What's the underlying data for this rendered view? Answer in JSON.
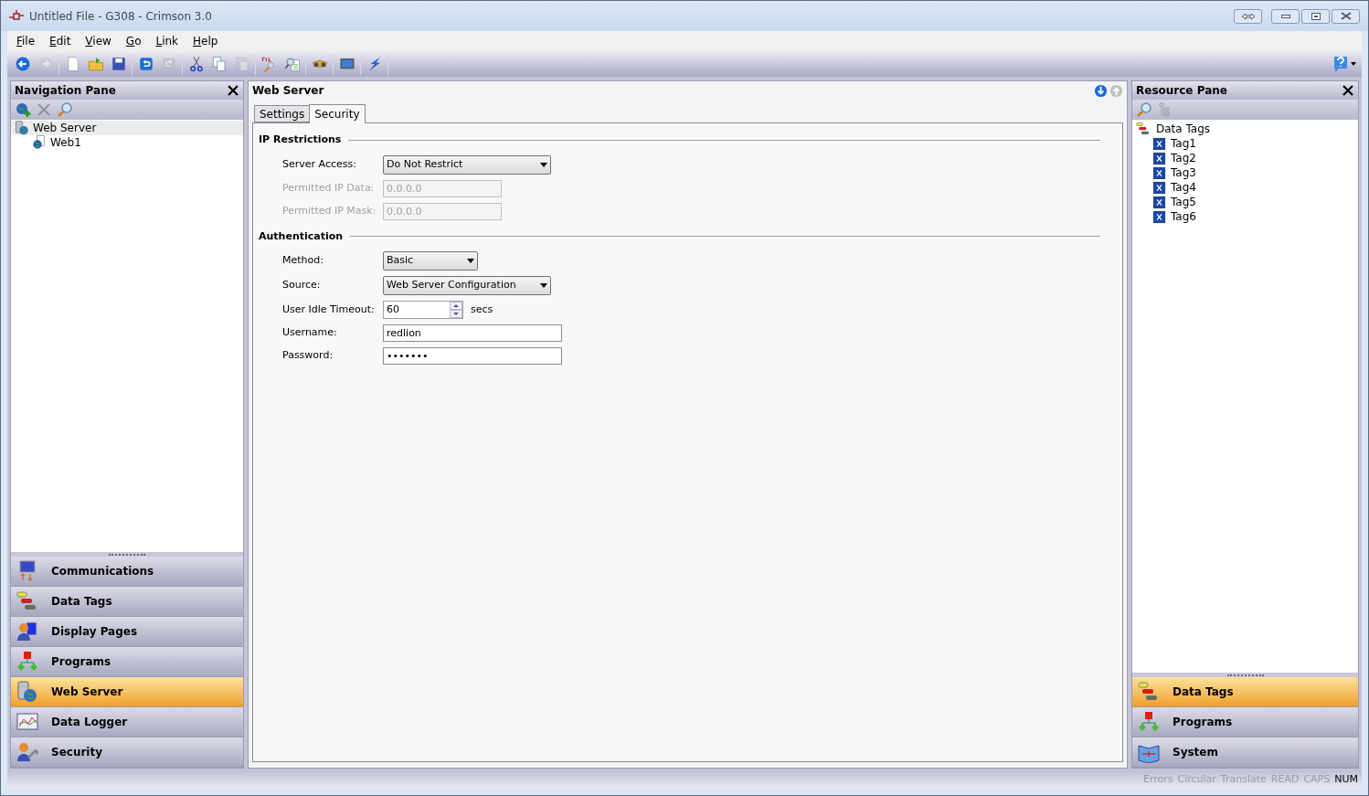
{
  "window": {
    "title": "Untitled File - G308 - Crimson 3.0"
  },
  "menu": [
    "File",
    "Edit",
    "View",
    "Go",
    "Link",
    "Help"
  ],
  "toolbar": [
    [
      {
        "kind": "back",
        "disabled": false
      },
      {
        "kind": "forward",
        "disabled": true
      }
    ],
    [
      {
        "kind": "new",
        "disabled": false
      },
      {
        "kind": "open",
        "disabled": false
      },
      {
        "kind": "save",
        "disabled": false
      }
    ],
    [
      {
        "kind": "undo",
        "disabled": false
      },
      {
        "kind": "redo",
        "disabled": true
      }
    ],
    [
      {
        "kind": "cut",
        "disabled": false
      },
      {
        "kind": "copy",
        "disabled": false
      },
      {
        "kind": "paste",
        "disabled": true
      }
    ],
    [
      {
        "kind": "find-all",
        "disabled": false
      },
      {
        "kind": "find",
        "disabled": false
      }
    ],
    [
      {
        "kind": "binoculars",
        "disabled": false
      }
    ],
    [
      {
        "kind": "monitor",
        "disabled": false
      }
    ],
    [
      {
        "kind": "lightning",
        "disabled": false
      }
    ]
  ],
  "navigation_pane": {
    "title": "Navigation Pane",
    "tree": [
      {
        "label": "Web Server",
        "kind": "server",
        "selected": true,
        "children": [
          {
            "label": "Web1",
            "kind": "globe",
            "selected": false
          }
        ]
      }
    ],
    "categories": [
      {
        "label": "Communications",
        "kind": "communications",
        "selected": false
      },
      {
        "label": "Data Tags",
        "kind": "tags",
        "selected": false
      },
      {
        "label": "Display Pages",
        "kind": "display",
        "selected": false
      },
      {
        "label": "Programs",
        "kind": "programs",
        "selected": false
      },
      {
        "label": "Web Server",
        "kind": "server",
        "selected": true
      },
      {
        "label": "Data Logger",
        "kind": "logger",
        "selected": false
      },
      {
        "label": "Security",
        "kind": "security",
        "selected": false
      }
    ]
  },
  "editor": {
    "title": "Web Server",
    "tabs": [
      {
        "label": "Settings",
        "selected": false
      },
      {
        "label": "Security",
        "selected": true
      }
    ],
    "sections": [
      {
        "title": "IP Restrictions",
        "fields": [
          {
            "kind": "select",
            "label": "Server Access:",
            "value": "Do Not Restrict",
            "disabled": false
          },
          {
            "kind": "text",
            "label": "Permitted IP Data:",
            "value": "0.0.0.0",
            "disabled": true
          },
          {
            "kind": "text",
            "label": "Permitted IP Mask:",
            "value": "0.0.0.0",
            "disabled": true
          }
        ]
      },
      {
        "title": "Authentication",
        "fields": [
          {
            "kind": "select",
            "label": "Method:",
            "value": "Basic",
            "disabled": false
          },
          {
            "kind": "select",
            "label": "Source:",
            "value": "Web Server Configuration",
            "disabled": false
          },
          {
            "kind": "spinner",
            "label": "User Idle Timeout:",
            "value": "60",
            "unit": "secs",
            "disabled": false
          },
          {
            "kind": "text",
            "label": "Username:",
            "value": "redlion",
            "disabled": false
          },
          {
            "kind": "text",
            "label": "Password:",
            "value": "•••••••",
            "disabled": false
          }
        ]
      }
    ]
  },
  "resource_pane": {
    "title": "Resource Pane",
    "tree": [
      {
        "label": "Data Tags",
        "kind": "tags",
        "children": [
          {
            "label": "Tag1",
            "kind": "tag"
          },
          {
            "label": "Tag2",
            "kind": "tag"
          },
          {
            "label": "Tag3",
            "kind": "tag"
          },
          {
            "label": "Tag4",
            "kind": "tag"
          },
          {
            "label": "Tag5",
            "kind": "tag"
          },
          {
            "label": "Tag6",
            "kind": "tag"
          }
        ]
      }
    ],
    "categories": [
      {
        "label": "Data Tags",
        "kind": "tags",
        "selected": true
      },
      {
        "label": "Programs",
        "kind": "programs",
        "selected": false
      },
      {
        "label": "System",
        "kind": "system",
        "selected": false
      }
    ]
  },
  "status_bar": [
    {
      "label": "Errors",
      "on": false
    },
    {
      "label": "Circular",
      "on": false
    },
    {
      "label": "Translate",
      "on": false
    },
    {
      "label": "READ",
      "on": false
    },
    {
      "label": "CAPS",
      "on": false
    },
    {
      "label": "NUM",
      "on": true
    }
  ]
}
